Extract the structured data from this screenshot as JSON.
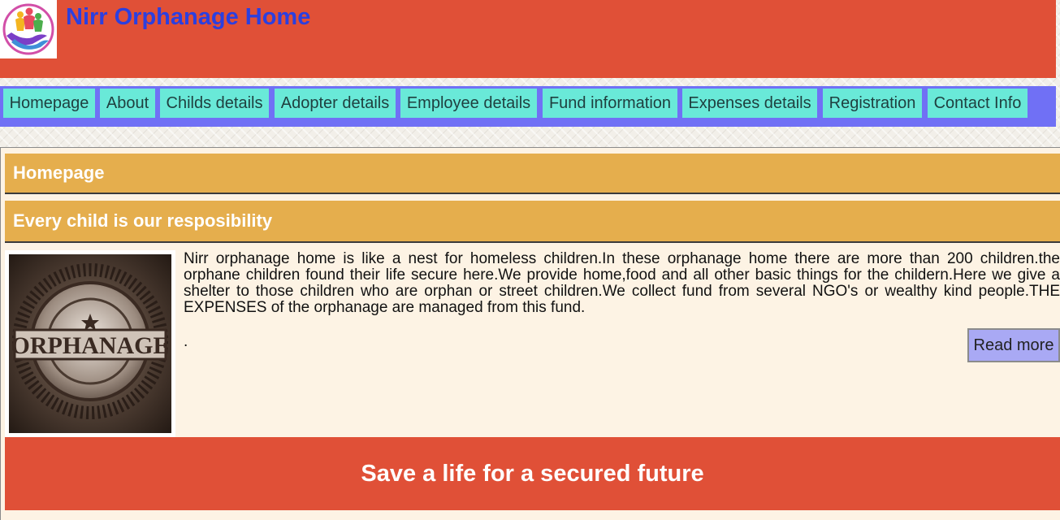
{
  "header": {
    "title": "Nirr Orphanage Home",
    "background_color": "#e05037",
    "title_color": "#2b3fe0",
    "logo_icon": "orphanage-hands-family-icon"
  },
  "nav": {
    "background_color": "#7070f5",
    "item_color": "#69e9d8",
    "items": [
      {
        "label": "Homepage"
      },
      {
        "label": "About"
      },
      {
        "label": "Childs details"
      },
      {
        "label": "Adopter details"
      },
      {
        "label": "Employee details"
      },
      {
        "label": "Fund information"
      },
      {
        "label": "Expenses details"
      },
      {
        "label": "Registration"
      },
      {
        "label": "Contact Info"
      }
    ]
  },
  "main": {
    "section_title": "Homepage",
    "tagline": "Every child is our resposibility",
    "image_label": "ORPHANAGE",
    "body": "Nirr orphanage home is like a nest for homeless children.In these orphanage home there are more than 200 children.the orphane children found their life secure here.We provide home,food and all other basic things for the childern.Here we give a shelter to those children who are orphan or street children.We collect fund from several NGO's or wealthy kind people.THE EXPENSES of the orphanage are managed from this fund.",
    "trailing": ".",
    "read_more_label": "Read more"
  },
  "footer": {
    "slogan": "Save a life for a secured future"
  }
}
